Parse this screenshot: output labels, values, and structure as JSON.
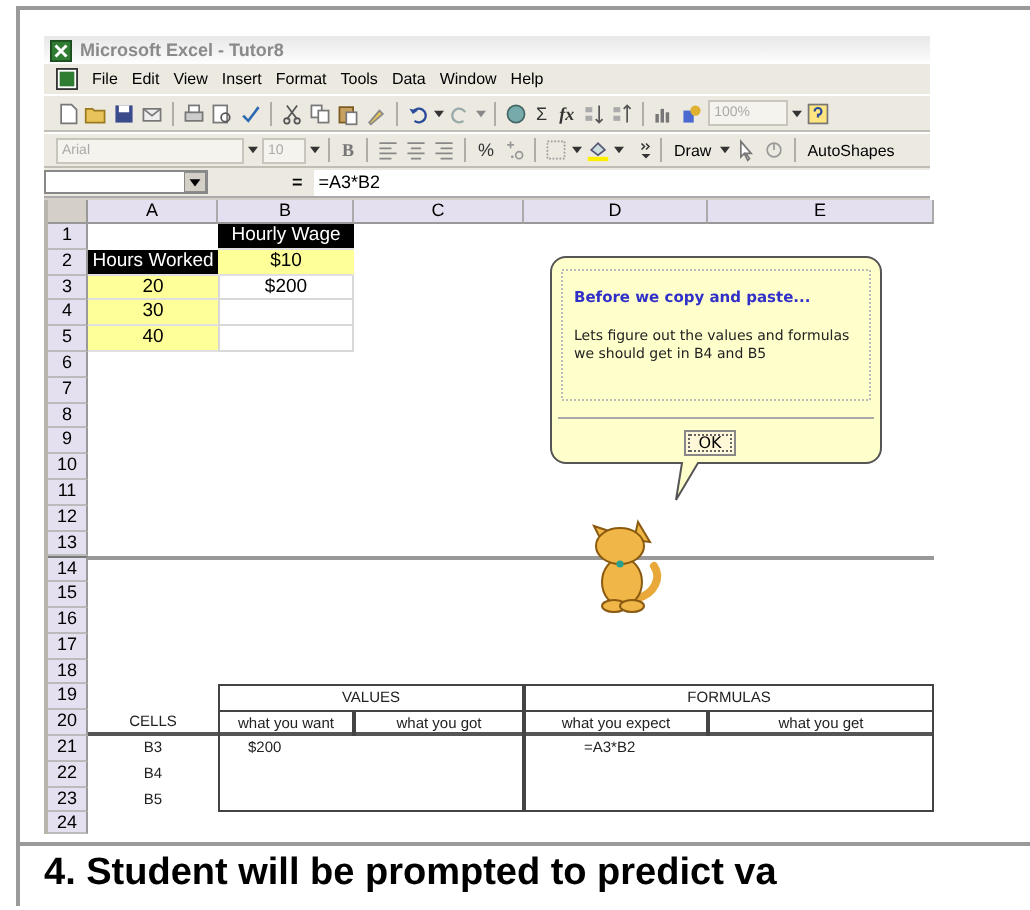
{
  "window": {
    "title": "Microsoft Excel - Tutor8"
  },
  "menu": [
    "File",
    "Edit",
    "View",
    "Insert",
    "Format",
    "Tools",
    "Data",
    "Window",
    "Help"
  ],
  "standard_toolbar": {
    "sum": "Σ",
    "function": "fx",
    "zoom": "100%"
  },
  "formatting_toolbar": {
    "font": "Arial",
    "size": "10",
    "bold": "B",
    "percent": "%",
    "draw": "Draw",
    "autoshapes": "AutoShapes"
  },
  "formula_bar": {
    "equals": "=",
    "formula": "=A3*B2"
  },
  "columns": [
    "A",
    "B",
    "C",
    "D",
    "E"
  ],
  "row_headers": [
    "1",
    "2",
    "3",
    "4",
    "5",
    "6",
    "7",
    "8",
    "9",
    "10",
    "11",
    "12",
    "13",
    "14",
    "15",
    "16",
    "17",
    "18",
    "19",
    "20",
    "21",
    "22",
    "23",
    "24"
  ],
  "rows": [
    {
      "cells": [
        {
          "kind": "blank"
        },
        {
          "kind": "heading",
          "text": "Hourly Wage"
        }
      ]
    },
    {
      "cells": [
        {
          "kind": "heading",
          "text": "Hours Worked"
        },
        {
          "kind": "input",
          "text": "$10"
        }
      ]
    },
    {
      "cells": [
        {
          "kind": "input",
          "text": "20"
        },
        {
          "kind": "result",
          "text": "$200"
        }
      ]
    },
    {
      "cells": [
        {
          "kind": "input",
          "text": "30"
        },
        {
          "kind": "result"
        }
      ]
    },
    {
      "cells": [
        {
          "kind": "input",
          "text": "40"
        },
        {
          "kind": "result"
        }
      ]
    }
  ],
  "summary": {
    "groups": [
      "VALUES",
      "FORMULAS"
    ],
    "columns": [
      "CELLS",
      "what you want",
      "what you got",
      "what you expect",
      "what you get"
    ],
    "rows": [
      {
        "cell": "B3",
        "want": "$200",
        "expect": "=A3*B2"
      },
      {
        "cell": "B4"
      },
      {
        "cell": "B5"
      }
    ]
  },
  "balloon": {
    "title": "Before we copy and paste...",
    "body": "Lets figure out the values and formulas we should get in B4 and B5",
    "button": "OK"
  },
  "caption": "4. Student will be prompted to predict va"
}
